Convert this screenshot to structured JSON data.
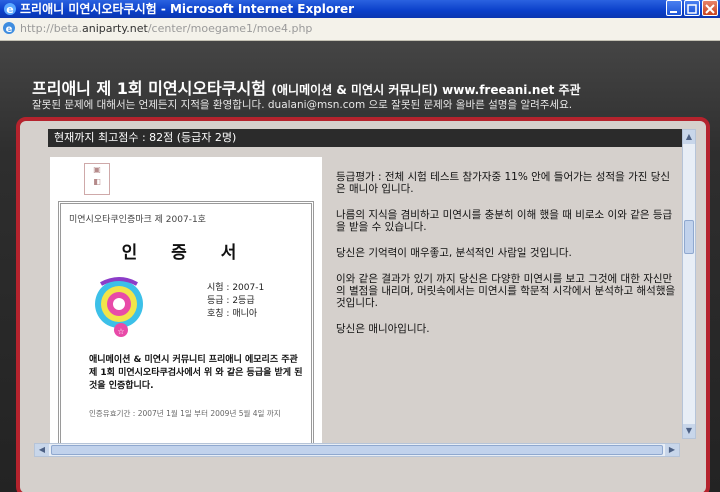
{
  "window": {
    "title": "프리애니 미연시오타쿠시험 - Microsoft Internet Explorer",
    "icon": "ie-icon"
  },
  "address": {
    "url_prefix": "http://beta.",
    "url_domain": "aniparty.net",
    "url_path": "/center/moegame1/moe4.php"
  },
  "header": {
    "title": "프리애니 제 1회 미연시오타쿠시험",
    "subtitle": "(애니메이션 & 미연시 커뮤니티) www.freeani.net 주관",
    "notice": "잘못된 문제에 대해서는 언제든지 지적을 환영합니다.  dualani@msn.com 으로 잘못된 문제와 올바른 설명을 알려주세요."
  },
  "score_bar": {
    "text": "현재까지 최고점수 : 82점 (등급자 2명)"
  },
  "certificate": {
    "issue_no": "미연시오타쿠인증마크 제 2007-1호",
    "heading": "인 증 서",
    "exam_label": "시험 : 2007-1",
    "grade_label": "등급 : 2등급",
    "title_label": "호칭 : 매니아",
    "body": "애니메이션 & 미연시 커뮤니티 프리애니 에모리즈 주관 제 1회 미연시오타쿠검사에서 위 와 같은 등급을 받게 된 것을 인증합니다.",
    "validity": "인증유효기간   : 2007년 1월 1일 부터 2009년 5월 4일 까지"
  },
  "result": {
    "line1": "등급평가 : 전체 시험 테스트 참가자중 11% 안에 들어가는 성적을 가진 당신은 매니아 입니다.",
    "line2": "나름의 지식을 겸비하고 미연시를 충분히 이해 했을 때 비로소 이와 같은 등급을 받을 수 있습니다.",
    "line3": "당신은 기억력이 매우좋고, 분석적인 사람일 것입니다.",
    "line4": "이와 같은 결과가 있기 까지 당신은 다양한 미연시를 보고 그것에 대한 자신만의 별점을 내리며, 머릿속에서는 미연시를 학문적 시각에서 분석하고 해석했을 것입니다.",
    "line5": "당신은 매니아입니다."
  },
  "scroll": {
    "up": "▲",
    "down": "▼",
    "left": "◀",
    "right": "▶"
  },
  "colors": {
    "titlebar": "#0a3fc9",
    "frame_border": "#b5232d",
    "score_bar": "#2b2b2b"
  }
}
